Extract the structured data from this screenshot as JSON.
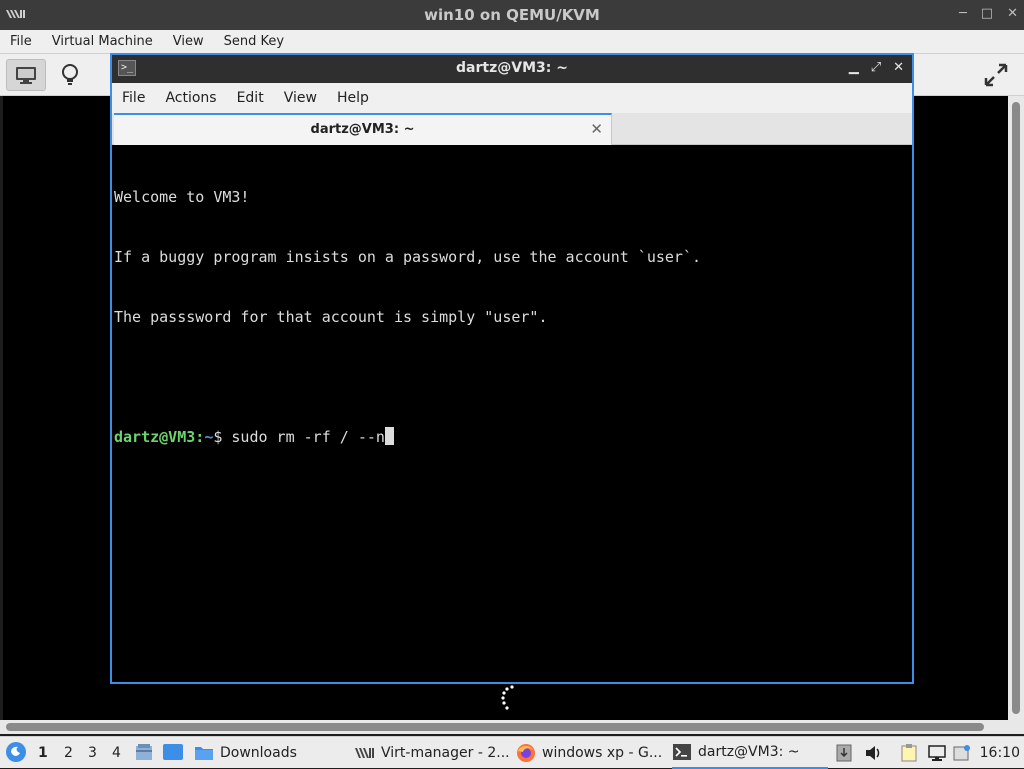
{
  "host": {
    "title": "win10 on QEMU/KVM",
    "menu": [
      "File",
      "Virtual Machine",
      "View",
      "Send Key"
    ],
    "window_buttons": [
      "─",
      "□",
      "✕"
    ]
  },
  "terminal": {
    "title": "dartz@VM3: ~",
    "menu": [
      "File",
      "Actions",
      "Edit",
      "View",
      "Help"
    ],
    "tab_label": "dartz@VM3: ~",
    "tab_close": "✕",
    "lines": [
      "Welcome to VM3!",
      "If a buggy program insists on a password, use the account `user`.",
      "The passsword for that account is simply \"user\".",
      ""
    ],
    "prompt": {
      "user": "dartz@VM3",
      "sep": ":",
      "path": "~",
      "dollar": "$ ",
      "command": "sudo rm -rf / --n"
    }
  },
  "taskbar": {
    "workspaces": [
      "1",
      "2",
      "3",
      "4"
    ],
    "active_workspace": "1",
    "tasks": [
      {
        "label": "Downloads",
        "icon": "folder-icon"
      },
      {
        "label": "Virt-manager - 2...",
        "icon": "virt-manager-icon"
      },
      {
        "label": "windows xp - G...",
        "icon": "firefox-icon"
      },
      {
        "label": "dartz@VM3: ~",
        "icon": "terminal-icon"
      }
    ],
    "clock": "16:10"
  },
  "colors": {
    "accent": "#3d8ee6",
    "prompt_user": "#6ed36e",
    "prompt_path": "#5b8fd8"
  }
}
